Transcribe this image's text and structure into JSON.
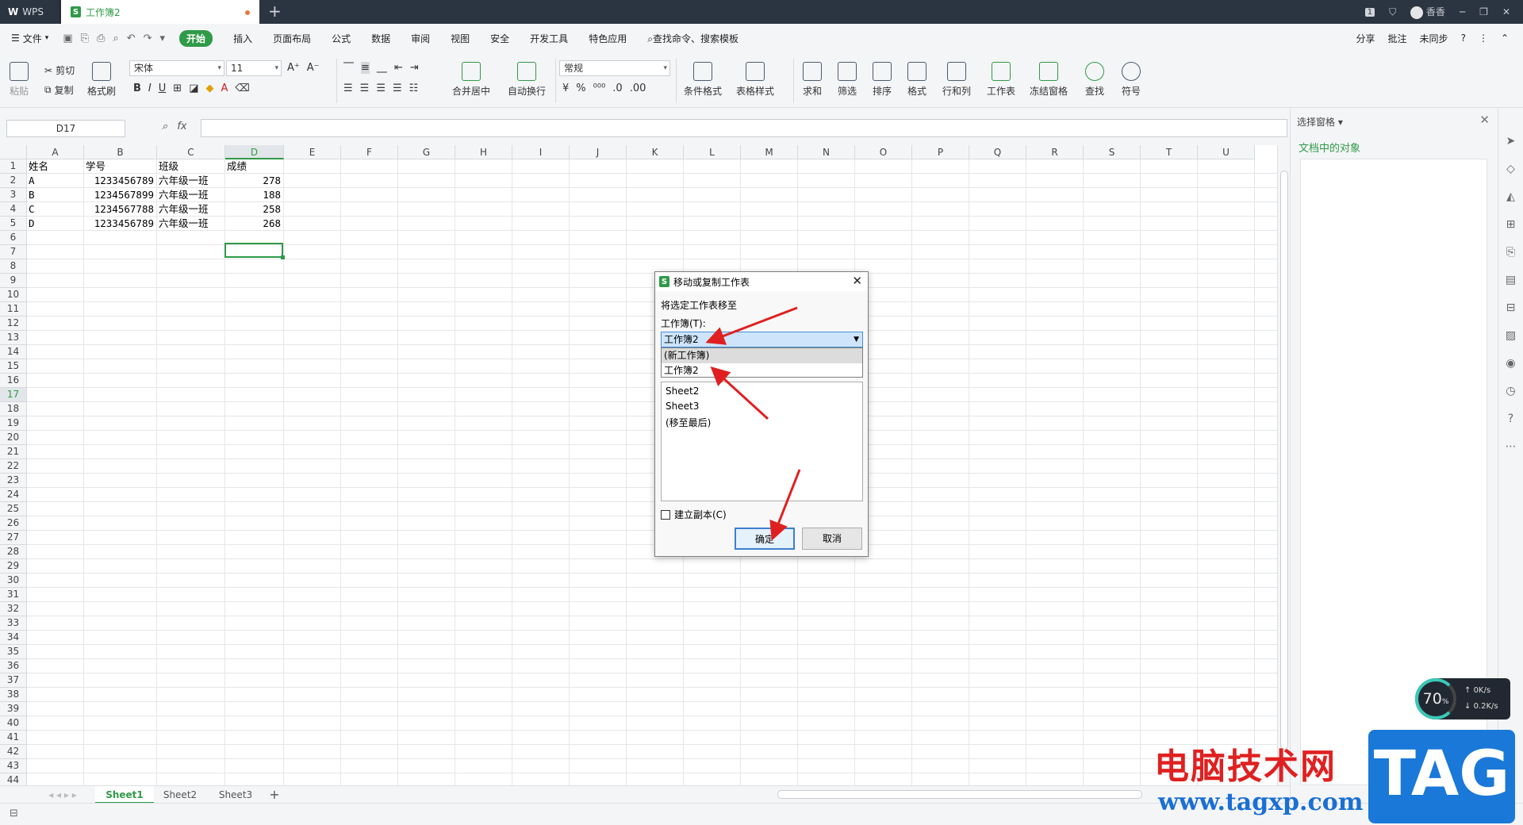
{
  "titlebar": {
    "app_tab": "WPS",
    "doc_tab": "工作簿2",
    "new_tab": "+",
    "window_badge": "1",
    "user": "香香"
  },
  "menu": {
    "file": "文件",
    "start": "开始",
    "items": [
      "插入",
      "页面布局",
      "公式",
      "数据",
      "审阅",
      "视图",
      "安全",
      "开发工具",
      "特色应用"
    ],
    "search": "查找命令、搜索模板",
    "right": [
      "分享",
      "批注",
      "未同步"
    ]
  },
  "ribbon": {
    "paste": "粘贴",
    "cut": "剪切",
    "copy": "复制",
    "format_painter": "格式刷",
    "font_name": "宋体",
    "font_size": "11",
    "merge": "合并居中",
    "wrap": "自动换行",
    "number_format": "常规",
    "conditional_format": "条件格式",
    "table_style": "表格样式",
    "sum": "求和",
    "filter": "筛选",
    "sort": "排序",
    "format": "格式",
    "row_col": "行和列",
    "worksheet": "工作表",
    "freeze": "冻结窗格",
    "find": "查找",
    "symbol": "符号"
  },
  "formula_bar": {
    "name_box": "D17",
    "fx": "fx",
    "value": ""
  },
  "grid": {
    "columns": [
      "A",
      "B",
      "C",
      "D",
      "E",
      "F",
      "G",
      "H",
      "I",
      "J",
      "K",
      "L",
      "M",
      "N",
      "O",
      "P",
      "Q",
      "R",
      "S",
      "T",
      "U"
    ],
    "selected_column": "D",
    "selected_row": 17,
    "rows": [
      [
        "姓名",
        "学号",
        "班级",
        "成绩"
      ],
      [
        "A",
        "1233456789",
        "六年级一班",
        "278"
      ],
      [
        "B",
        "1234567899",
        "六年级一班",
        "188"
      ],
      [
        "C",
        "1234567788",
        "六年级一班",
        "258"
      ],
      [
        "D",
        "1233456789",
        "六年级一班",
        "268"
      ]
    ],
    "row_count": 44
  },
  "sheets": [
    "Sheet1",
    "Sheet2",
    "Sheet3"
  ],
  "add_sheet": "+",
  "right_pane": {
    "title": "选择窗格",
    "subtitle": "文档中的对象"
  },
  "dialog": {
    "title": "移动或复制工作表",
    "move_to_label": "将选定工作表移至",
    "workbook_label": "工作簿(T):",
    "workbook_selected": "工作簿2",
    "dropdown_options": [
      "(新工作簿)",
      "工作簿2"
    ],
    "sheet_list": [
      "Sheet2",
      "Sheet3",
      "(移至最后)"
    ],
    "copy_checkbox": "建立副本(C)",
    "ok": "确定",
    "cancel": "取消"
  },
  "overlay": {
    "perf_value": "70",
    "perf_unit": "%",
    "upload": "0K/s",
    "download": "0.2K/s",
    "watermark_text": "电脑技术网",
    "watermark_url": "www.tagxp.com",
    "watermark_logo": "TAG"
  },
  "colors": {
    "accent": "#2f9a48",
    "annotation_arrow": "#e02020"
  }
}
